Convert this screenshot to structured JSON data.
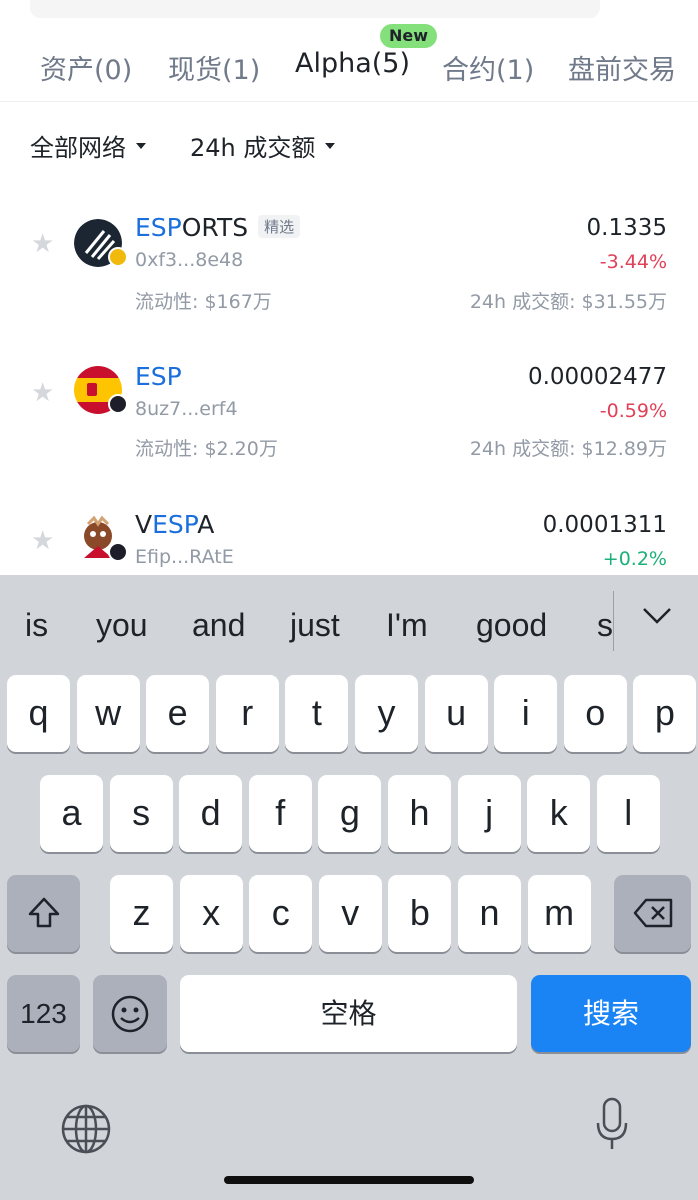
{
  "tabs": [
    {
      "label": "资产(0)"
    },
    {
      "label": "现货(1)"
    },
    {
      "label": "Alpha(5)",
      "badge": "New"
    },
    {
      "label": "合约(1)"
    },
    {
      "label": "盘前交易"
    }
  ],
  "filters": {
    "network": "全部网络",
    "sort": "24h 成交额"
  },
  "tokens": [
    {
      "symbol_hl": "ESP",
      "symbol_rest": "ORTS",
      "tag": "精选",
      "address": "0xf3...8e48",
      "liquidity": "流动性: $167万",
      "price": "0.1335",
      "change": "-3.44%",
      "volume": "24h 成交额: $31.55万"
    },
    {
      "symbol_hl": "ESP",
      "symbol_rest": "",
      "address": "8uz7...erf4",
      "liquidity": "流动性: $2.20万",
      "price": "0.00002477",
      "change": "-0.59%",
      "volume": "24h 成交额: $12.89万"
    },
    {
      "symbol_pre": "V",
      "symbol_hl": "ESP",
      "symbol_rest": "A",
      "address": "Efip...RAtE",
      "price": "0.0001311",
      "change": "+0.2%"
    }
  ],
  "keyboard": {
    "suggestions": [
      "is",
      "you",
      "and",
      "just",
      "I'm",
      "good",
      "s"
    ],
    "row1": [
      "q",
      "w",
      "e",
      "r",
      "t",
      "y",
      "u",
      "i",
      "o",
      "p"
    ],
    "row2": [
      "a",
      "s",
      "d",
      "f",
      "g",
      "h",
      "j",
      "k",
      "l"
    ],
    "row3": [
      "z",
      "x",
      "c",
      "v",
      "b",
      "n",
      "m"
    ],
    "numbers_label": "123",
    "space_label": "空格",
    "search_label": "搜索"
  },
  "colors": {
    "highlight": "#1a6fdc",
    "negative": "#e04058",
    "positive": "#1cb07a",
    "badge_new": "#84e07a",
    "search_key": "#1b84f5"
  }
}
